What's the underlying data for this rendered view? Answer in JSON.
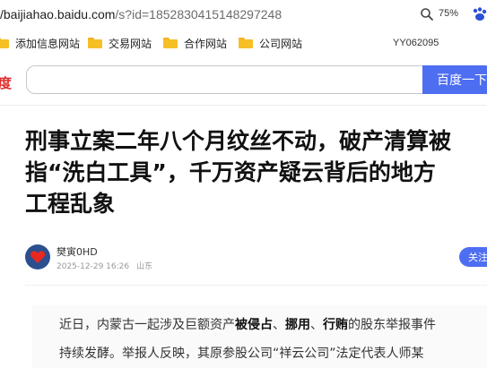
{
  "browser": {
    "url_host": "/baijiahao.baidu.com",
    "url_path": "/s?id=1852830415148297248",
    "zoom_label": "75%",
    "zoom_icon": "magnifier-icon",
    "page_icon": "baidu-paw-icon"
  },
  "bookmarks": {
    "items": [
      {
        "label": "添加信息网站",
        "icon": "folder-icon"
      },
      {
        "label": "交易网站",
        "icon": "folder-icon"
      },
      {
        "label": "合作网站",
        "icon": "folder-icon"
      },
      {
        "label": "公司网站",
        "icon": "folder-icon"
      }
    ],
    "user_label": "YY062095"
  },
  "header": {
    "logo_text": "度",
    "search_value": "",
    "search_button": "百度一下"
  },
  "article": {
    "title_lines": [
      "刑事立案二年八个月纹丝不动，破产清算被",
      "指“洗白工具”，千万资产疑云背后的地方",
      "工程乱象"
    ],
    "author": {
      "name": "樊寅0HD",
      "date": "2025-12-29 16:26",
      "location": "山东",
      "follow_label": "关注"
    },
    "paragraph": {
      "line1_a": "近日，内蒙古一起涉及巨额资产",
      "line1_b": "被侵占",
      "line1_c": "、",
      "line1_d": "挪用",
      "line1_e": "、",
      "line1_f": "行贿",
      "line1_g": "的股东举报事件",
      "line2": "持续发酵。举报人反映，其原参股公司“祥云公司”法定代表人师某"
    }
  },
  "colors": {
    "accent": "#4e6ef2",
    "logo_red": "#e02b2b",
    "folder": "#f6bf26"
  }
}
